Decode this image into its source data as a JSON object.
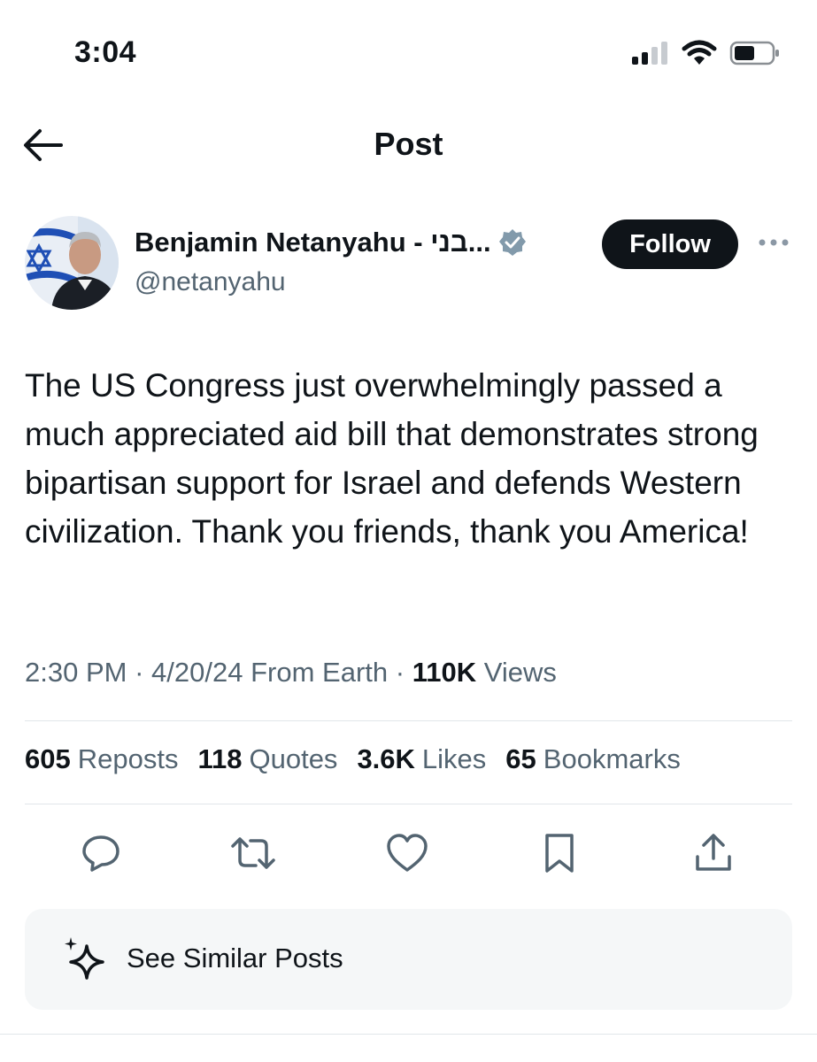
{
  "status_bar": {
    "time": "3:04",
    "icons": [
      "cellular-signal-icon",
      "wifi-icon",
      "battery-icon"
    ]
  },
  "nav": {
    "title": "Post",
    "back_icon": "arrow-left-icon"
  },
  "author": {
    "name": "Benjamin Netanyahu - בני...",
    "handle": "@netanyahu",
    "verified_icon": "verified-badge-icon",
    "follow_label": "Follow",
    "more_icon": "more-horizontal-icon"
  },
  "post": {
    "text": "The US Congress just overwhelmingly passed a much appreciated aid bill that demonstrates strong bipartisan support for Israel and defends Western civilization. Thank you friends, thank you America!",
    "time": "2:30 PM",
    "date": "4/20/24",
    "source": "From Earth",
    "views_count": "110K",
    "views_label": "Views",
    "separator": "·"
  },
  "stats": [
    {
      "count": "605",
      "label": "Reposts"
    },
    {
      "count": "118",
      "label": "Quotes"
    },
    {
      "count": "3.6K",
      "label": "Likes"
    },
    {
      "count": "65",
      "label": "Bookmarks"
    }
  ],
  "actions": [
    "reply-icon",
    "repost-icon",
    "like-icon",
    "bookmark-icon",
    "share-icon"
  ],
  "similar": {
    "label": "See Similar Posts",
    "icon": "sparkle-icon"
  },
  "colors": {
    "text": "#0f1419",
    "secondary": "#536471",
    "divider": "#e1e6ea",
    "verified": "#829aab",
    "follow_bg": "#0f1419",
    "panel_bg": "#f5f7f8"
  }
}
